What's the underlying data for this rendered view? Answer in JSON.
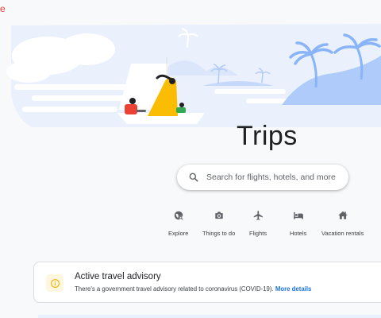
{
  "logo_fragment": "e",
  "page": {
    "title": "Trips"
  },
  "search": {
    "placeholder": "Search for flights, hotels, and more"
  },
  "categories": [
    {
      "label": "Explore",
      "icon": "explore-icon"
    },
    {
      "label": "Things to do",
      "icon": "camera-icon"
    },
    {
      "label": "Flights",
      "icon": "airplane-icon"
    },
    {
      "label": "Hotels",
      "icon": "bed-icon"
    },
    {
      "label": "Vacation rentals",
      "icon": "house-icon"
    }
  ],
  "advisory": {
    "title": "Active travel advisory",
    "body": "There's a government travel advisory related to coronavirus (COVID-19).",
    "link": "More details",
    "icon": "info-icon"
  },
  "colors": {
    "accent": "#1a73e8",
    "title_text": "#202124",
    "advisory_icon": "#f9ab00",
    "hero_sky": "#e8f0fe",
    "hero_land": "#aecbfa"
  }
}
